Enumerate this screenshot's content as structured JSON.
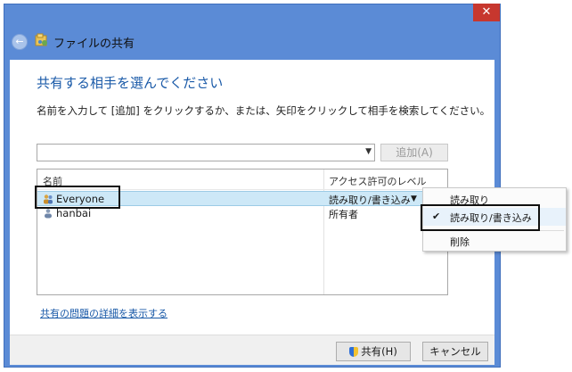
{
  "window": {
    "title": "ファイルの共有",
    "close_glyph": "✕",
    "back_glyph": "←"
  },
  "content": {
    "heading": "共有する相手を選んでください",
    "instruction": "名前を入力して [追加] をクリックするか、または、矢印をクリックして相手を検索してください。",
    "combo_value": "",
    "add_button": "追加(A)",
    "list": {
      "col_name": "名前",
      "col_access": "アクセス許可のレベル",
      "rows": [
        {
          "name": "Everyone",
          "access": "読み取り/書き込み",
          "selected": true
        },
        {
          "name": "hanbai",
          "access": "所有者",
          "selected": false
        }
      ]
    },
    "help_link": "共有の問題の詳細を表示する"
  },
  "footer": {
    "share_button": "共有(H)",
    "cancel_button": "キャンセル"
  },
  "context_menu": {
    "items": [
      {
        "label": "読み取り",
        "checked": false
      },
      {
        "label": "読み取り/書き込み",
        "checked": true
      },
      {
        "label": "削除",
        "checked": false
      }
    ],
    "check_glyph": "✔"
  },
  "colors": {
    "window_frame": "#5b8bd6",
    "close_button": "#c7372e",
    "heading": "#1a5aa8",
    "selection": "#cde8f7"
  }
}
